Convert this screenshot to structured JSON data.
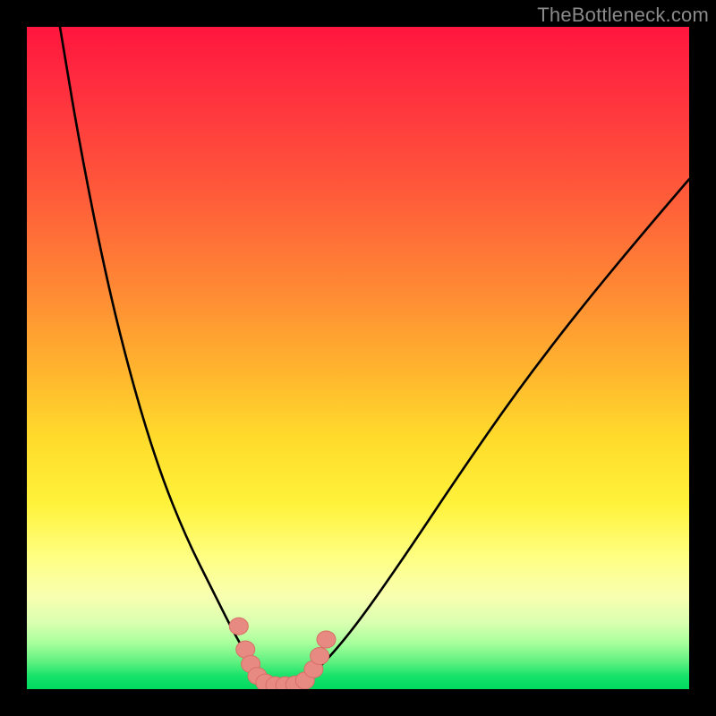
{
  "watermark": {
    "text": "TheBottleneck.com"
  },
  "colors": {
    "background": "#000000",
    "curve": "#000000",
    "marker_fill": "#e78a82",
    "marker_stroke": "#d76f67",
    "gradient_top": "#ff163e",
    "gradient_bottom": "#00d95f"
  },
  "chart_data": {
    "type": "line",
    "title": "",
    "xlabel": "",
    "ylabel": "",
    "xlim": [
      0,
      100
    ],
    "ylim": [
      0,
      100
    ],
    "grid": false,
    "legend": false,
    "curves": [
      {
        "name": "left-curve",
        "description": "steep descending curve from top-left into the trough",
        "x": [
          5,
          8,
          12,
          16,
          20,
          24,
          28,
          31,
          33,
          34.5,
          36,
          37.5
        ],
        "y": [
          100,
          82,
          62,
          46,
          33,
          23,
          15,
          9,
          5.5,
          3,
          1.2,
          0.3
        ]
      },
      {
        "name": "right-curve",
        "description": "ascending curve from trough toward upper-right",
        "x": [
          40,
          42,
          45,
          50,
          57,
          65,
          74,
          84,
          94,
          100
        ],
        "y": [
          0.3,
          1.5,
          4,
          10,
          20,
          32,
          45,
          58,
          70,
          77
        ]
      }
    ],
    "markers": {
      "name": "trough-markers",
      "description": "cluster of salmon pill-shaped markers across the valley bottom",
      "points": [
        {
          "x": 32.0,
          "y": 9.5
        },
        {
          "x": 33.0,
          "y": 6.0
        },
        {
          "x": 33.8,
          "y": 3.8
        },
        {
          "x": 34.8,
          "y": 2.0
        },
        {
          "x": 36.0,
          "y": 1.0
        },
        {
          "x": 37.5,
          "y": 0.6
        },
        {
          "x": 39.0,
          "y": 0.6
        },
        {
          "x": 40.5,
          "y": 0.7
        },
        {
          "x": 42.0,
          "y": 1.3
        },
        {
          "x": 43.3,
          "y": 3.0
        },
        {
          "x": 44.2,
          "y": 5.0
        },
        {
          "x": 45.2,
          "y": 7.5
        }
      ]
    }
  }
}
